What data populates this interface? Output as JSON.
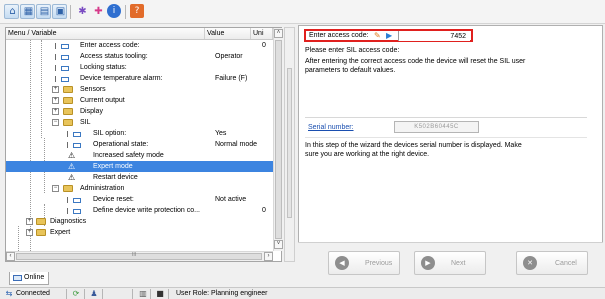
{
  "toolbar": {
    "icons": [
      "home-icon",
      "table-icon",
      "list-view-icon",
      "window-icon",
      "wand-icon",
      "add-icon",
      "info-icon",
      "help-icon"
    ]
  },
  "tree": {
    "columns": [
      "Menu / Variable",
      "Value",
      "Uni"
    ],
    "rows": [
      {
        "label": "Enter access code:",
        "value": "0"
      },
      {
        "label": "Access status tooling:",
        "value": "Operator"
      },
      {
        "label": "Locking status:",
        "value": ""
      },
      {
        "label": "Device temperature alarm:",
        "value": "Failure (F)"
      },
      {
        "label": "Sensors",
        "value": ""
      },
      {
        "label": "Current output",
        "value": ""
      },
      {
        "label": "Display",
        "value": ""
      },
      {
        "label": "SIL",
        "value": ""
      },
      {
        "label": "SIL option:",
        "value": "Yes"
      },
      {
        "label": "Operational state:",
        "value": "Normal mode"
      },
      {
        "label": "Increased safety mode",
        "value": ""
      },
      {
        "label": "Expert mode",
        "value": ""
      },
      {
        "label": "Restart device",
        "value": ""
      },
      {
        "label": "Administration",
        "value": ""
      },
      {
        "label": "Device reset:",
        "value": "Not active"
      },
      {
        "label": "Define device write protection co...",
        "value": "0"
      },
      {
        "label": "Diagnostics",
        "value": ""
      },
      {
        "label": "Expert",
        "value": ""
      }
    ],
    "selected": "Expert mode",
    "hscroll_marker": "III"
  },
  "wizard": {
    "access_label": "Enter access code:",
    "access_value": "7452",
    "instruction": "Please enter SIL access code:",
    "note_line1": "After entering the correct access code the device will reset the SIL user",
    "note_line2": "parameters to default values.",
    "serial_label": "Serial number:",
    "serial_value": "K502B60445C",
    "serial_note_line1": "In this step of the wizard the devices serial number is displayed. Make",
    "serial_note_line2": "sure you are working at the right device."
  },
  "nav": {
    "previous": "Previous",
    "next": "Next",
    "cancel": "Cancel"
  },
  "tabs": {
    "online": "Online"
  },
  "status": {
    "connected": "Connected",
    "user_role": "User Role: Planning engineer"
  },
  "colors": {
    "highlight": "#e0201e",
    "selection": "#3c84e0",
    "link": "#1a4fb0"
  }
}
